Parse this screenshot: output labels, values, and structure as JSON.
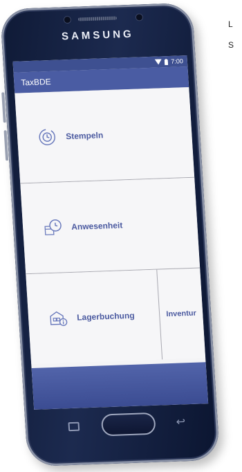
{
  "corner": {
    "t1": "L",
    "t2": "S"
  },
  "phone": {
    "brand": "SAMSUNG"
  },
  "status": {
    "time": "7:00"
  },
  "app": {
    "title": "TaxBDE",
    "tiles": [
      {
        "label": "Stempeln",
        "icon": "clock-refresh-icon"
      },
      {
        "label": "Anwesenheit",
        "icon": "calendar-clock-icon"
      },
      {
        "label": "Lagerbuchung",
        "icon": "warehouse-info-icon"
      },
      {
        "label": "Inventur"
      }
    ]
  },
  "colors": {
    "primary": "#4a5ca3",
    "statusbar": "#3e5091",
    "accent": "#4b5aa0"
  }
}
